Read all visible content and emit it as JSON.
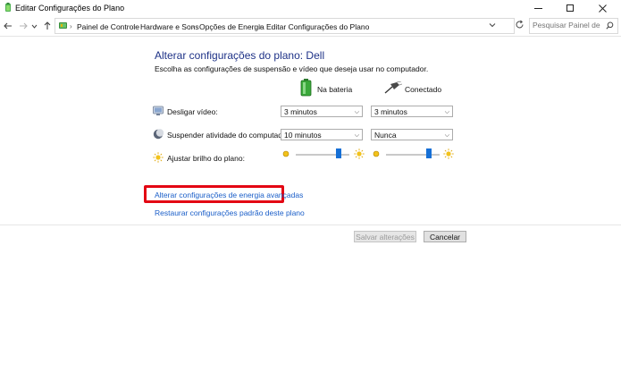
{
  "window": {
    "title": "Editar Configurações do Plano"
  },
  "nav": {
    "breadcrumbs": [
      "Painel de Controle",
      "Hardware e Sons",
      "Opções de Energia",
      "Editar Configurações do Plano"
    ],
    "search_placeholder": "Pesquisar Painel de Co..."
  },
  "content": {
    "heading": "Alterar configurações do plano: Dell",
    "subheading": "Escolha as configurações de suspensão e vídeo que deseja usar no computador.",
    "columns": {
      "battery": "Na bateria",
      "plugged": "Conectado"
    },
    "rows": [
      {
        "label": "Desligar vídeo:",
        "battery": "3 minutos",
        "plugged": "3 minutos",
        "icon": "monitor-icon"
      },
      {
        "label": "Suspender atividade do computador:",
        "battery": "10 minutos",
        "plugged": "Nunca",
        "icon": "moon-icon"
      },
      {
        "label": "Ajustar brilho do plano:",
        "icon": "sun-icon",
        "battery_brightness": 0.8,
        "plugged_brightness": 0.8
      }
    ],
    "links": {
      "advanced": "Alterar configurações de energia avançadas",
      "restore": "Restaurar configurações padrão deste plano"
    },
    "buttons": {
      "save": "Salvar alterações",
      "cancel": "Cancelar"
    }
  },
  "colors": {
    "heading": "#1e3287",
    "link": "#1a5ec8",
    "highlight": "#e30613",
    "slider_thumb": "#1670d6"
  }
}
